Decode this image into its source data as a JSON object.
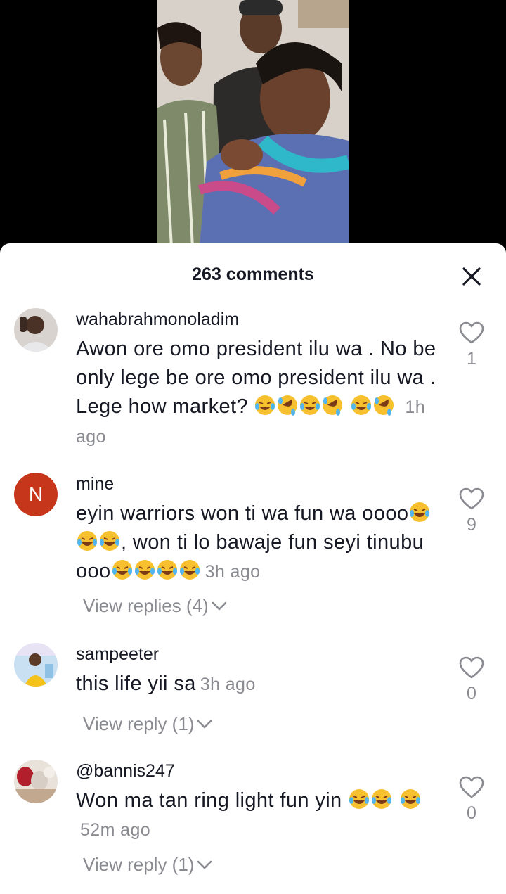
{
  "header": {
    "comment_count_label": "263 comments"
  },
  "comments": [
    {
      "username": "wahabrahmonoladim",
      "text": "Awon ore omo president ilu wa . No be only lege be ore omo president ilu wa . Lege how market?",
      "emoji_after": [
        "laugh-tears",
        "rofl",
        "laugh-tears",
        "rofl",
        "laugh-tears",
        "rofl"
      ],
      "time": "1h ago",
      "likes": "1"
    },
    {
      "username": "mine",
      "avatar_letter": "N",
      "text_part1": "eyin warriors won ti wa fun wa oooo",
      "text_part2": ", won ti lo bawaje fun seyi tinubu ooo",
      "time": "3h ago",
      "likes": "9",
      "replies_label": "View replies (4)"
    },
    {
      "username": "sampeeter",
      "text": "this life yii sa",
      "time": "3h ago",
      "likes": "0",
      "replies_label": "View reply (1)"
    },
    {
      "username": "@bannis247",
      "text": "Won ma tan ring light fun yin",
      "time": "52m ago",
      "likes": "0",
      "replies_label": "View reply (1)"
    }
  ],
  "colors": {
    "text": "#161823",
    "muted": "#8a8b91",
    "avatar_mine": "#c6361b"
  },
  "icons": {
    "close": "close-icon",
    "like": "heart-outline-icon",
    "chevron": "chevron-down-icon"
  }
}
